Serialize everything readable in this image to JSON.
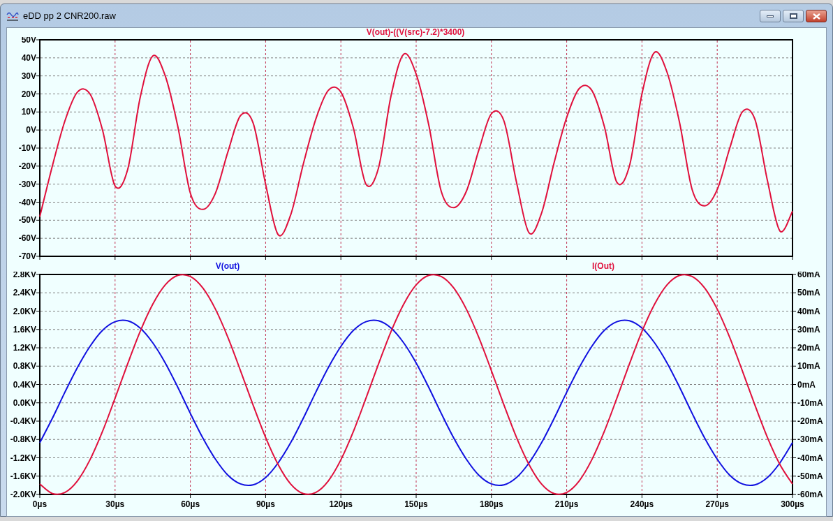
{
  "window": {
    "title": "eDD pp 2 CNR200.raw"
  },
  "panes": [
    {
      "chart_data": {
        "type": "line",
        "x": [
          0,
          5,
          10,
          15,
          20,
          25,
          30,
          35,
          40,
          45,
          50,
          55,
          60,
          65,
          70,
          75,
          80,
          85,
          90,
          95,
          100,
          105,
          110,
          115,
          120,
          125,
          130,
          135,
          140,
          145,
          150,
          155,
          160,
          165,
          170,
          175,
          180,
          185,
          190,
          195,
          200,
          205,
          210,
          215,
          220,
          225,
          230,
          235,
          240,
          245,
          250,
          255,
          260,
          265,
          270,
          275,
          280,
          285,
          290,
          295,
          300
        ],
        "series": [
          {
            "name": "V(out)-((V(src)-7.2)*3400)",
            "color": "#e0103c",
            "values": [
              -48,
              -20,
              5,
              21,
              20,
              0,
              -31,
              -22,
              18,
              41,
              30,
              2,
              -35,
              -44,
              -35,
              -12,
              8,
              4,
              -30,
              -58,
              -47,
              -19,
              6,
              22,
              21,
              1,
              -30,
              -21,
              19,
              42,
              31,
              3,
              -34,
              -43,
              -34,
              -11,
              9,
              5,
              -29,
              -57,
              -46,
              -18,
              7,
              23,
              22,
              2,
              -29,
              -20,
              20,
              43,
              32,
              4,
              -33,
              -42,
              -33,
              -10,
              10,
              6,
              -28,
              -56,
              -45
            ]
          }
        ],
        "xlim": [
          0,
          300
        ],
        "ylim": [
          -70,
          50
        ],
        "grid": true,
        "yticks": [
          {
            "value": 50,
            "label": "50V"
          },
          {
            "value": 40,
            "label": "40V"
          },
          {
            "value": 30,
            "label": "30V"
          },
          {
            "value": 20,
            "label": "20V"
          },
          {
            "value": 10,
            "label": "10V"
          },
          {
            "value": 0,
            "label": "0V"
          },
          {
            "value": -10,
            "label": "-10V"
          },
          {
            "value": -20,
            "label": "-20V"
          },
          {
            "value": -30,
            "label": "-30V"
          },
          {
            "value": -40,
            "label": "-40V"
          },
          {
            "value": -50,
            "label": "-50V"
          },
          {
            "value": -60,
            "label": "-60V"
          },
          {
            "value": -70,
            "label": "-70V"
          }
        ]
      }
    },
    {
      "chart_data": {
        "type": "line",
        "x": [
          0,
          5,
          10,
          15,
          20,
          25,
          30,
          35,
          40,
          45,
          50,
          55,
          60,
          65,
          70,
          75,
          80,
          85,
          90,
          95,
          100,
          105,
          110,
          115,
          120,
          125,
          130,
          135,
          140,
          145,
          150,
          155,
          160,
          165,
          170,
          175,
          180,
          185,
          190,
          195,
          200,
          205,
          210,
          215,
          220,
          225,
          230,
          235,
          240,
          245,
          250,
          255,
          260,
          265,
          270,
          275,
          280,
          285,
          290,
          295,
          300
        ],
        "series": [
          {
            "name": "V(out)",
            "color": "#1010e0",
            "values": [
              -0.87,
              -0.34,
              0.23,
              0.77,
              1.23,
              1.58,
              1.77,
              1.79,
              1.63,
              1.31,
              0.87,
              0.34,
              -0.23,
              -0.77,
              -1.23,
              -1.58,
              -1.77,
              -1.79,
              -1.63,
              -1.31,
              -0.87,
              -0.34,
              0.23,
              0.77,
              1.23,
              1.58,
              1.77,
              1.79,
              1.63,
              1.31,
              0.87,
              0.34,
              -0.23,
              -0.77,
              -1.23,
              -1.58,
              -1.77,
              -1.79,
              -1.63,
              -1.31,
              -0.87,
              -0.34,
              0.23,
              0.77,
              1.23,
              1.58,
              1.77,
              1.79,
              1.63,
              1.31,
              0.87,
              0.34,
              -0.23,
              -0.77,
              -1.23,
              -1.58,
              -1.77,
              -1.79,
              -1.63,
              -1.31,
              -0.87
            ]
          },
          {
            "name": "I(Out)",
            "color": "#e0103c",
            "axis": "y2",
            "values": [
              -54.3,
              -59.5,
              -58.9,
              -52.6,
              -41.1,
              -25.6,
              -7.5,
              11.2,
              28.9,
              43.7,
              54.3,
              59.5,
              58.9,
              52.6,
              41.1,
              25.6,
              7.5,
              -11.2,
              -28.9,
              -43.7,
              -54.3,
              -59.5,
              -58.9,
              -52.6,
              -41.1,
              -25.6,
              -7.5,
              11.2,
              28.9,
              43.7,
              54.3,
              59.5,
              58.9,
              52.6,
              41.1,
              25.6,
              7.5,
              -11.2,
              -28.9,
              -43.7,
              -54.3,
              -59.5,
              -58.9,
              -52.6,
              -41.1,
              -25.6,
              -7.5,
              11.2,
              28.9,
              43.7,
              54.3,
              59.5,
              58.9,
              52.6,
              41.1,
              25.6,
              7.5,
              -11.2,
              -28.9,
              -43.7,
              -54.3
            ]
          }
        ],
        "xlim": [
          0,
          300
        ],
        "ylim": [
          -2.0,
          2.8
        ],
        "grid": true,
        "y2lim": [
          -60,
          60
        ],
        "xticks": [
          {
            "value": 0,
            "label": "0µs"
          },
          {
            "value": 30,
            "label": "30µs"
          },
          {
            "value": 60,
            "label": "60µs"
          },
          {
            "value": 90,
            "label": "90µs"
          },
          {
            "value": 120,
            "label": "120µs"
          },
          {
            "value": 150,
            "label": "150µs"
          },
          {
            "value": 180,
            "label": "180µs"
          },
          {
            "value": 210,
            "label": "210µs"
          },
          {
            "value": 240,
            "label": "240µs"
          },
          {
            "value": 270,
            "label": "270µs"
          },
          {
            "value": 300,
            "label": "300µs"
          }
        ],
        "yticks": [
          {
            "value": 2.8,
            "label": "2.8KV"
          },
          {
            "value": 2.4,
            "label": "2.4KV"
          },
          {
            "value": 2.0,
            "label": "2.0KV"
          },
          {
            "value": 1.6,
            "label": "1.6KV"
          },
          {
            "value": 1.2,
            "label": "1.2KV"
          },
          {
            "value": 0.8,
            "label": "0.8KV"
          },
          {
            "value": 0.4,
            "label": "0.4KV"
          },
          {
            "value": 0,
            "label": "0.0KV"
          },
          {
            "value": -0.4,
            "label": "-0.4KV"
          },
          {
            "value": -0.8,
            "label": "-0.8KV"
          },
          {
            "value": -1.2,
            "label": "-1.2KV"
          },
          {
            "value": -1.6,
            "label": "-1.6KV"
          },
          {
            "value": -2.0,
            "label": "-2.0KV"
          }
        ],
        "y2ticks": [
          {
            "value": 60,
            "label": "60mA"
          },
          {
            "value": 50,
            "label": "50mA"
          },
          {
            "value": 40,
            "label": "40mA"
          },
          {
            "value": 30,
            "label": "30mA"
          },
          {
            "value": 20,
            "label": "20mA"
          },
          {
            "value": 10,
            "label": "10mA"
          },
          {
            "value": 0,
            "label": "0mA"
          },
          {
            "value": -10,
            "label": "-10mA"
          },
          {
            "value": -20,
            "label": "-20mA"
          },
          {
            "value": -30,
            "label": "-30mA"
          },
          {
            "value": -40,
            "label": "-40mA"
          },
          {
            "value": -50,
            "label": "-50mA"
          },
          {
            "value": -60,
            "label": "-60mA"
          }
        ]
      }
    }
  ]
}
